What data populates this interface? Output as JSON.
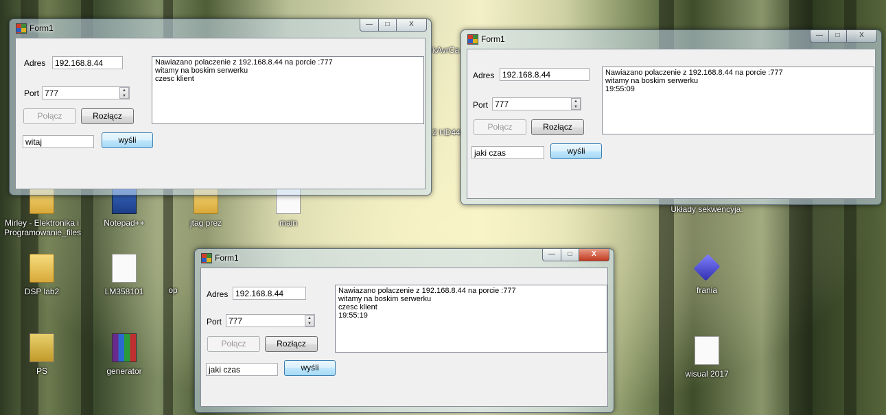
{
  "desktop": {
    "icons": [
      {
        "label": "Mirley - Elektronika i Programowanie_files",
        "icon": "folder-icon"
      },
      {
        "label": "Notepad++",
        "icon": "notepad-plus-plus-icon"
      },
      {
        "label": "jtag prez",
        "icon": "folder-icon"
      },
      {
        "label": "main",
        "icon": "document-icon"
      },
      {
        "label": "Układy sekwencyja.",
        "icon": "folder-icon"
      },
      {
        "label": "DSP lab2",
        "icon": "folder-icon"
      },
      {
        "label": "LM358101",
        "icon": "document-icon"
      },
      {
        "label": "op",
        "icon": "folder-icon"
      },
      {
        "label": "frania",
        "icon": "vhdl-cube-icon"
      },
      {
        "label": "PS",
        "icon": "photoshop-file-icon"
      },
      {
        "label": "generator",
        "icon": "winrar-archive-icon"
      },
      {
        "label": "wisual 2017",
        "icon": "document-icon"
      },
      {
        "label": "kAvrCa",
        "icon": "folder-icon"
      },
      {
        "label": "2 HD44",
        "icon": "folder-icon"
      }
    ]
  },
  "windows": [
    {
      "title": "Form1",
      "address_label": "Adres",
      "address_value": "192.168.8.44",
      "port_label": "Port",
      "port_value": "777",
      "connect_label": "Połącz",
      "disconnect_label": "Rozłącz",
      "message_value": "witaj",
      "send_label": "wyśli",
      "log": [
        "Nawiazano polaczenie z 192.168.8.44 na porcie :777",
        "witamy na boskim serwerku",
        "czesc klient"
      ],
      "controls": {
        "minimize": "—",
        "maximize": "□",
        "close": "X"
      }
    },
    {
      "title": "Form1",
      "address_label": "Adres",
      "address_value": "192.168.8.44",
      "port_label": "Port",
      "port_value": "777",
      "connect_label": "Połącz",
      "disconnect_label": "Rozłącz",
      "message_value": "jaki czas",
      "send_label": "wyśli",
      "log": [
        "Nawiazano polaczenie z 192.168.8.44 na porcie :777",
        "witamy na boskim serwerku",
        "19:55:09"
      ],
      "controls": {
        "minimize": "—",
        "maximize": "□",
        "close": "X"
      }
    },
    {
      "title": "Form1",
      "address_label": "Adres",
      "address_value": "192.168.8.44",
      "port_label": "Port",
      "port_value": "777",
      "connect_label": "Połącz",
      "disconnect_label": "Rozłącz",
      "message_value": "jaki czas",
      "send_label": "wyśli",
      "log": [
        "Nawiazano polaczenie z 192.168.8.44 na porcie :777",
        "witamy na boskim serwerku",
        "czesc klient",
        "19:55:19"
      ],
      "controls": {
        "minimize": "—",
        "maximize": "□",
        "close": "X"
      }
    }
  ],
  "colors": {
    "aero_glass": "#c8dcf0",
    "close_active": "#c13a1f",
    "button_focus": "#3c7fb1"
  }
}
